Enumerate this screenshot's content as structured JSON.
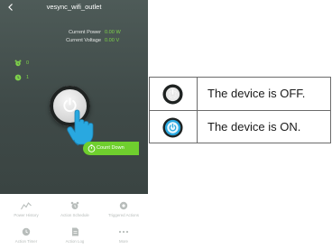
{
  "app": {
    "title": "vesync_wifi_outlet",
    "back_icon": "chevron-left-icon"
  },
  "readout": {
    "power_label": "Current Power",
    "power_value": "0.00 W",
    "voltage_label": "Current Voltage",
    "voltage_value": "0.00 V"
  },
  "stats": [
    {
      "icon": "alarm-clock-icon",
      "value": "0"
    },
    {
      "icon": "clock-icon",
      "value": "1"
    }
  ],
  "power_button": {
    "icon": "power-icon"
  },
  "countdown": {
    "label": "Count Down",
    "icon": "timer-icon"
  },
  "nav": [
    {
      "label": "Power History",
      "icon": "chart-line-icon"
    },
    {
      "label": "Action Schedule",
      "icon": "alarm-clock-icon"
    },
    {
      "label": "Triggered Actions",
      "icon": "trigger-icon"
    },
    {
      "label": "Action Timer",
      "icon": "clock-icon"
    },
    {
      "label": "Action Log",
      "icon": "document-icon"
    },
    {
      "label": "More",
      "icon": "more-icon"
    }
  ],
  "legend": [
    {
      "text": "The device is OFF.",
      "icon": "power-off-icon"
    },
    {
      "text": "The device is ON.",
      "icon": "power-on-icon"
    }
  ],
  "colors": {
    "accent_green": "#7ed24a",
    "countdown_green": "#6fcf2e",
    "on_blue": "#29a8e0",
    "screen_bg": "#46524f"
  }
}
